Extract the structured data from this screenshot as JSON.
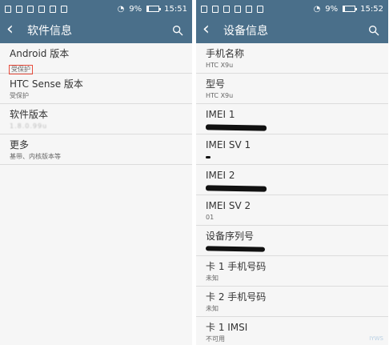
{
  "statusbar": {
    "battery_percent": "9%",
    "left_time": "15:51",
    "right_time": "15:52"
  },
  "left": {
    "title": "软件信息",
    "items": [
      {
        "title": "Android 版本",
        "sub": "受保护"
      },
      {
        "title": "HTC Sense 版本",
        "sub": "受保护"
      },
      {
        "title": "软件版本",
        "sub": "1.8.0.99u"
      },
      {
        "title": "更多",
        "sub": "基带、内核版本等"
      }
    ]
  },
  "right": {
    "title": "设备信息",
    "items": [
      {
        "title": "手机名称",
        "sub": "HTC X9u"
      },
      {
        "title": "型号",
        "sub": "HTC X9u"
      },
      {
        "title": "IMEI 1",
        "sub": ""
      },
      {
        "title": "IMEI SV 1",
        "sub": ""
      },
      {
        "title": "IMEI 2",
        "sub": ""
      },
      {
        "title": "IMEI SV 2",
        "sub": "01"
      },
      {
        "title": "设备序列号",
        "sub": ""
      },
      {
        "title": "卡 1 手机号码",
        "sub": "未知"
      },
      {
        "title": "卡 2 手机号码",
        "sub": "未知"
      },
      {
        "title": "卡 1 IMSI",
        "sub": "不可用"
      }
    ]
  },
  "watermark": "IYWS"
}
